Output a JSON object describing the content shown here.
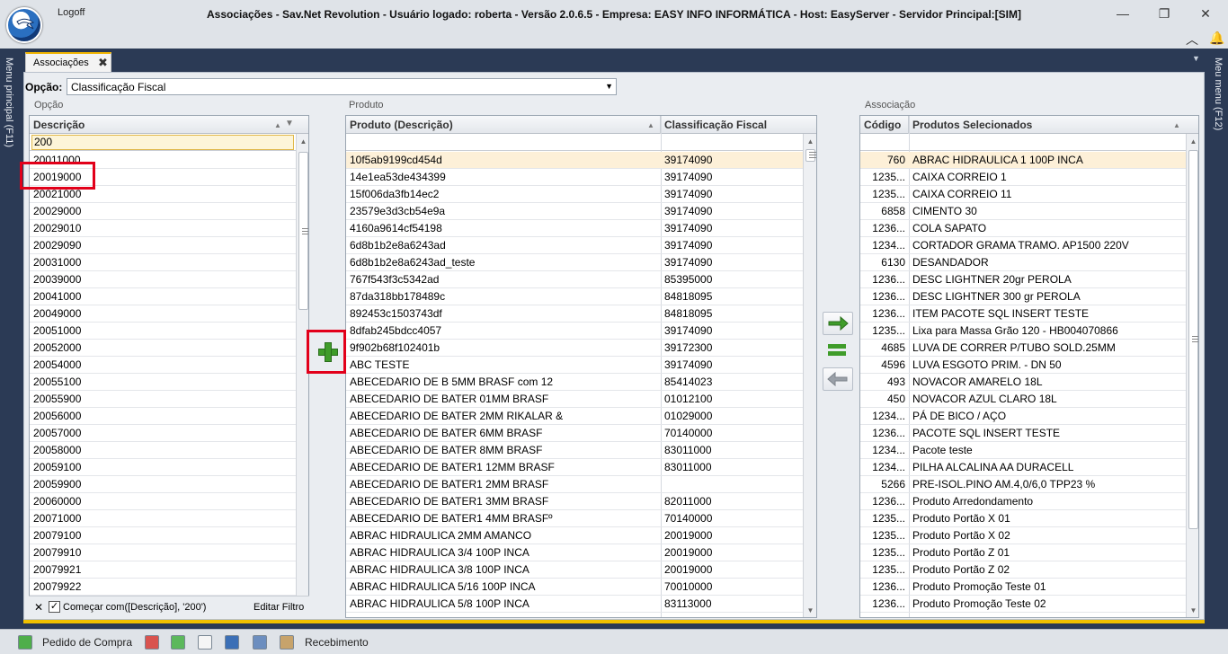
{
  "window": {
    "logoff_label": "Logoff",
    "title": "Associações - Sav.Net Revolution - Usuário logado: roberta - Versão 2.0.6.5 - Empresa: EASY INFO INFORMÁTICA - Host: EasyServer - Servidor Principal:[SIM]"
  },
  "side": {
    "left_label": "Menu principal (F11)",
    "right_label": "Meu menu (F12)"
  },
  "tab": {
    "label": "Associações",
    "close": "✖"
  },
  "option": {
    "label": "Opção:",
    "value": "Classificação Fiscal"
  },
  "groups": {
    "option": "Opção",
    "product": "Produto",
    "association": "Associação"
  },
  "option_grid": {
    "header": "Descrição",
    "filter_value": "200",
    "rows": [
      "20011000",
      "20019000",
      "20021000",
      "20029000",
      "20029010",
      "20029090",
      "20031000",
      "20039000",
      "20041000",
      "20049000",
      "20051000",
      "20052000",
      "20054000",
      "20055100",
      "20055900",
      "20056000",
      "20057000",
      "20058000",
      "20059100",
      "20059900",
      "20060000",
      "20071000",
      "20079100",
      "20079910",
      "20079921",
      "20079922"
    ],
    "footer": {
      "clear": "✕",
      "checked": "✓",
      "condition": "Começar com([Descrição], '200')",
      "edit": "Editar Filtro"
    }
  },
  "product_grid": {
    "headers": [
      "Produto (Descrição)",
      "Classificação Fiscal"
    ],
    "rows": [
      [
        "10f5ab9199cd454d",
        "39174090"
      ],
      [
        "14e1ea53de434399",
        "39174090"
      ],
      [
        "15f006da3fb14ec2",
        "39174090"
      ],
      [
        "23579e3d3cb54e9a",
        "39174090"
      ],
      [
        "4160a9614cf54198",
        "39174090"
      ],
      [
        "6d8b1b2e8a6243ad",
        "39174090"
      ],
      [
        "6d8b1b2e8a6243ad_teste",
        "39174090"
      ],
      [
        "767f543f3c5342ad",
        "85395000"
      ],
      [
        "87da318bb178489c",
        "84818095"
      ],
      [
        "892453c1503743df",
        "84818095"
      ],
      [
        "8dfab245bdcc4057",
        "39174090"
      ],
      [
        "9f902b68f102401b",
        "39172300"
      ],
      [
        "ABC TESTE",
        "39174090"
      ],
      [
        "ABECEDARIO DE B 5MM BRASF com 12",
        "85414023"
      ],
      [
        "ABECEDARIO DE BATER 01MM BRASF",
        "01012100"
      ],
      [
        "ABECEDARIO DE BATER 2MM RIKALAR &",
        "01029000"
      ],
      [
        "ABECEDARIO DE BATER 6MM BRASF",
        "70140000"
      ],
      [
        "ABECEDARIO DE BATER 8MM BRASF",
        "83011000"
      ],
      [
        "ABECEDARIO DE BATER1 12MM BRASF",
        "83011000"
      ],
      [
        "ABECEDARIO DE BATER1 2MM BRASF",
        ""
      ],
      [
        "ABECEDARIO DE BATER1 3MM BRASF",
        "82011000"
      ],
      [
        "ABECEDARIO DE BATER1 4MM BRASFº",
        "70140000"
      ],
      [
        "ABRAC HIDRAULICA 2MM AMANCO",
        "20019000"
      ],
      [
        "ABRAC HIDRAULICA 3/4 100P INCA",
        "20019000"
      ],
      [
        "ABRAC HIDRAULICA 3/8 100P INCA",
        "20019000"
      ],
      [
        "ABRAC HIDRAULICA 5/16 100P INCA",
        "70010000"
      ],
      [
        "ABRAC HIDRAULICA 5/8 100P INCA",
        "83113000"
      ]
    ]
  },
  "assoc_grid": {
    "headers": [
      "Código",
      "Produtos Selecionados"
    ],
    "rows": [
      [
        "760",
        "ABRAC HIDRAULICA 1 100P INCA"
      ],
      [
        "1235...",
        "CAIXA CORREIO 1"
      ],
      [
        "1235...",
        "CAIXA CORREIO 11"
      ],
      [
        "6858",
        "CIMENTO 30"
      ],
      [
        "1236...",
        "COLA SAPATO"
      ],
      [
        "1234...",
        "CORTADOR GRAMA TRAMO. AP1500 220V"
      ],
      [
        "6130",
        "DESANDADOR"
      ],
      [
        "1236...",
        "DESC LIGHTNER 20gr PEROLA"
      ],
      [
        "1236...",
        "DESC LIGHTNER 300 gr PEROLA"
      ],
      [
        "1236...",
        "ITEM PACOTE SQL INSERT TESTE"
      ],
      [
        "1235...",
        "Lixa para Massa Grão 120 - HB004070866"
      ],
      [
        "4685",
        "LUVA DE CORRER P/TUBO SOLD.25MM"
      ],
      [
        "4596",
        "LUVA ESGOTO PRIM. - DN 50"
      ],
      [
        "493",
        "NOVACOR AMARELO 18L"
      ],
      [
        "450",
        "NOVACOR AZUL CLARO 18L"
      ],
      [
        "1234...",
        "PÁ DE BICO / AÇO"
      ],
      [
        "1236...",
        "PACOTE SQL INSERT TESTE"
      ],
      [
        "1234...",
        "Pacote teste"
      ],
      [
        "1234...",
        "PILHA ALCALINA AA DURACELL"
      ],
      [
        "5266",
        "PRE-ISOL.PINO AM.4,0/6,0 TPP23 %"
      ],
      [
        "1236...",
        "Produto Arredondamento"
      ],
      [
        "1235...",
        "Produto Portão X 01"
      ],
      [
        "1235...",
        "Produto Portão X 02"
      ],
      [
        "1235...",
        "Produto Portão Z 01"
      ],
      [
        "1235...",
        "Produto Portão Z 02"
      ],
      [
        "1236...",
        "Produto Promoção Teste 01"
      ],
      [
        "1236...",
        "Produto Promoção Teste 02"
      ]
    ]
  },
  "taskbar": {
    "item1": "Pedido de Compra",
    "item2": "Recebimento"
  },
  "colors": {
    "accent_gold": "#f0c000",
    "highlight_red": "#e2001a",
    "add_green": "#3f9c2a",
    "selected_row": "#fdf0d8"
  }
}
